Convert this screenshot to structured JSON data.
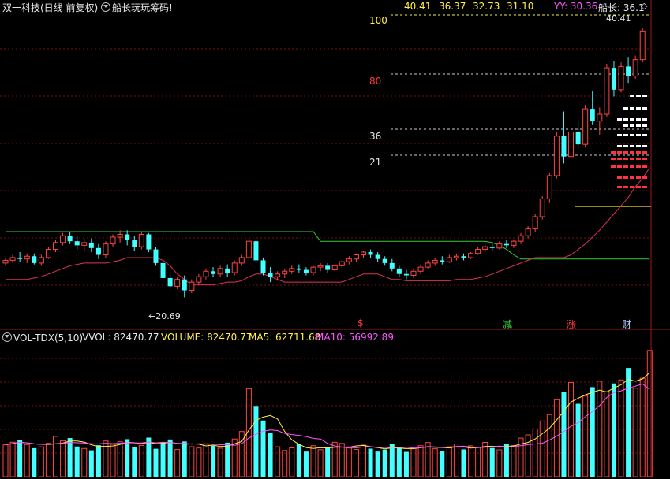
{
  "header": {
    "stock_title": "双一科技(日线 前复权)",
    "indicator_name": "船长玩玩筹码!",
    "readouts": [
      "40.41",
      "36.37",
      "32.73",
      "31.10"
    ],
    "yy_label": "YY: 30.36",
    "captain_label": "船长: 36.1"
  },
  "price_panel": {
    "level_labels": [
      "100",
      "80",
      "36",
      "21"
    ],
    "high_label": "40.41",
    "low_label": "20.69",
    "markers": [
      "$",
      "减",
      "涨",
      "财"
    ]
  },
  "volume_panel": {
    "indicator": "VOL-TDX(5,10)",
    "vvol": "VVOL: 82470.77",
    "volume": "VOLUME: 82470.77",
    "ma5": "MA5: 62711.68",
    "ma10": "MA10: 56992.89"
  },
  "colors": {
    "up": "#ff4444",
    "down": "#44ffff",
    "ma5": "#ffee44",
    "ma10": "#ff55ff",
    "support": "#33cc33",
    "bottom": "#dd3355"
  },
  "chart_data": {
    "type": "candlestick",
    "series": [
      {
        "name": "K",
        "ohlc": [
          [
            23.2,
            23.6,
            23.0,
            23.4
          ],
          [
            23.4,
            23.8,
            23.2,
            23.6
          ],
          [
            23.6,
            24.0,
            23.3,
            23.5
          ],
          [
            23.5,
            23.9,
            23.2,
            23.7
          ],
          [
            23.7,
            23.9,
            23.1,
            23.2
          ],
          [
            23.2,
            23.8,
            23.0,
            23.6
          ],
          [
            23.6,
            24.4,
            23.5,
            24.2
          ],
          [
            24.2,
            24.9,
            24.0,
            24.7
          ],
          [
            24.7,
            25.4,
            24.5,
            25.2
          ],
          [
            25.2,
            25.5,
            24.6,
            24.8
          ],
          [
            24.8,
            25.2,
            24.2,
            24.5
          ],
          [
            24.5,
            25.0,
            24.1,
            24.7
          ],
          [
            24.7,
            25.0,
            24.0,
            24.3
          ],
          [
            24.3,
            24.6,
            23.5,
            23.8
          ],
          [
            23.8,
            24.8,
            23.6,
            24.6
          ],
          [
            24.6,
            25.3,
            24.4,
            25.1
          ],
          [
            25.1,
            25.6,
            24.7,
            25.3
          ],
          [
            25.3,
            25.6,
            24.5,
            24.9
          ],
          [
            24.9,
            25.2,
            24.1,
            24.4
          ],
          [
            24.4,
            25.5,
            24.2,
            25.3
          ],
          [
            25.3,
            25.4,
            24.0,
            24.2
          ],
          [
            24.2,
            24.4,
            23.0,
            23.2
          ],
          [
            23.2,
            23.4,
            21.9,
            22.1
          ],
          [
            22.1,
            22.4,
            21.3,
            21.5
          ],
          [
            21.5,
            22.2,
            21.3,
            22.0
          ],
          [
            22.0,
            22.3,
            20.69,
            21.2
          ],
          [
            21.2,
            22.0,
            21.0,
            21.8
          ],
          [
            21.8,
            22.4,
            21.6,
            22.2
          ],
          [
            22.2,
            22.8,
            22.0,
            22.6
          ],
          [
            22.6,
            22.9,
            22.2,
            22.4
          ],
          [
            22.4,
            23.0,
            22.2,
            22.8
          ],
          [
            22.8,
            23.1,
            22.2,
            22.5
          ],
          [
            22.5,
            23.4,
            22.3,
            23.2
          ],
          [
            23.2,
            23.8,
            23.0,
            23.6
          ],
          [
            23.6,
            25.0,
            23.4,
            24.8
          ],
          [
            24.8,
            25.0,
            23.2,
            23.4
          ],
          [
            23.4,
            23.6,
            22.3,
            22.5
          ],
          [
            22.5,
            22.9,
            21.8,
            22.2
          ],
          [
            22.2,
            22.6,
            21.9,
            22.4
          ],
          [
            22.4,
            22.8,
            22.1,
            22.6
          ],
          [
            22.6,
            23.0,
            22.4,
            22.8
          ],
          [
            22.8,
            23.1,
            22.5,
            22.7
          ],
          [
            22.7,
            22.9,
            22.3,
            22.5
          ],
          [
            22.5,
            23.0,
            22.3,
            22.9
          ],
          [
            22.9,
            23.2,
            22.6,
            23.0
          ],
          [
            23.0,
            23.2,
            22.5,
            22.7
          ],
          [
            22.7,
            23.1,
            22.6,
            23.0
          ],
          [
            23.0,
            23.4,
            22.8,
            23.3
          ],
          [
            23.3,
            23.7,
            23.1,
            23.5
          ],
          [
            23.5,
            23.9,
            23.3,
            23.8
          ],
          [
            23.8,
            24.1,
            23.6,
            24.0
          ],
          [
            24.0,
            24.2,
            23.6,
            23.8
          ],
          [
            23.8,
            24.0,
            23.3,
            23.5
          ],
          [
            23.5,
            23.7,
            23.0,
            23.2
          ],
          [
            23.2,
            23.5,
            22.6,
            22.8
          ],
          [
            22.8,
            23.0,
            22.2,
            22.4
          ],
          [
            22.4,
            22.7,
            22.0,
            22.3
          ],
          [
            22.3,
            22.8,
            22.1,
            22.6
          ],
          [
            22.6,
            23.1,
            22.4,
            22.9
          ],
          [
            22.9,
            23.4,
            22.8,
            23.2
          ],
          [
            23.2,
            23.6,
            23.0,
            23.4
          ],
          [
            23.4,
            23.7,
            23.1,
            23.3
          ],
          [
            23.3,
            23.8,
            23.2,
            23.6
          ],
          [
            23.6,
            23.9,
            23.4,
            23.7
          ],
          [
            23.7,
            23.9,
            23.4,
            23.6
          ],
          [
            23.6,
            24.0,
            23.5,
            23.9
          ],
          [
            23.9,
            24.4,
            23.8,
            24.2
          ],
          [
            24.2,
            24.6,
            24.0,
            24.4
          ],
          [
            24.4,
            24.7,
            24.1,
            24.3
          ],
          [
            24.3,
            24.8,
            24.2,
            24.6
          ],
          [
            24.6,
            24.9,
            24.3,
            24.5
          ],
          [
            24.5,
            24.9,
            24.3,
            24.8
          ],
          [
            24.8,
            25.4,
            24.6,
            25.2
          ],
          [
            25.2,
            25.9,
            25.0,
            25.7
          ],
          [
            25.7,
            26.8,
            25.5,
            26.6
          ],
          [
            26.6,
            28.1,
            26.4,
            27.9
          ],
          [
            27.9,
            29.8,
            27.6,
            29.6
          ],
          [
            29.6,
            32.8,
            29.4,
            32.5
          ],
          [
            32.5,
            34.3,
            30.5,
            31.0
          ],
          [
            31.0,
            33.0,
            30.6,
            32.8
          ],
          [
            32.8,
            33.6,
            31.6,
            31.9
          ],
          [
            31.9,
            34.8,
            31.7,
            34.5
          ],
          [
            34.5,
            35.8,
            33.3,
            33.6
          ],
          [
            33.6,
            34.6,
            32.6,
            34.1
          ],
          [
            34.1,
            37.8,
            33.9,
            37.5
          ],
          [
            37.5,
            38.0,
            35.4,
            35.9
          ],
          [
            35.9,
            37.9,
            35.7,
            37.6
          ],
          [
            37.6,
            38.3,
            36.4,
            36.9
          ],
          [
            36.9,
            38.4,
            36.7,
            38.1
          ],
          [
            38.1,
            40.41,
            37.9,
            40.2
          ]
        ]
      }
    ],
    "volume_series": [
      {
        "name": "VOLUME",
        "values": [
          20800,
          22500,
          24100,
          21000,
          18600,
          19500,
          21800,
          26300,
          23500,
          25200,
          19700,
          18400,
          17200,
          20500,
          23300,
          21100,
          22800,
          24500,
          19100,
          20400,
          25500,
          18200,
          22400,
          24300,
          17700,
          23000,
          19600,
          18700,
          21500,
          20200,
          18600,
          22200,
          24600,
          29500,
          57500,
          46200,
          36700,
          28400,
          19500,
          17100,
          18800,
          21300,
          16400,
          20200,
          17600,
          19000,
          22500,
          21700,
          19400,
          17800,
          20600,
          18300,
          16400,
          17700,
          21200,
          19400,
          16200,
          18600,
          20200,
          22300,
          18200,
          16800,
          19500,
          21300,
          17800,
          20100,
          19200,
          22400,
          18700,
          17500,
          21300,
          20300,
          25200,
          27300,
          31200,
          36400,
          40600,
          50300,
          55400,
          61500,
          47600,
          52700,
          58500,
          62400,
          55600,
          60900,
          63200,
          71000,
          57800,
          64300,
          82470.77
        ]
      },
      {
        "name": "MA5",
        "values": [
          20800,
          21650,
          22470,
          22100,
          21400,
          21140,
          20980,
          21440,
          21940,
          23260,
          23300,
          22620,
          20800,
          19800,
          19820,
          20040,
          21060,
          22440,
          22160,
          21580,
          22460,
          21540,
          21720,
          22560,
          21620,
          21120,
          21440,
          21200,
          20100,
          20600,
          19720,
          19840,
          21420,
          22980,
          30480,
          36760,
          38940,
          40020,
          37700,
          29580,
          24100,
          21120,
          19000,
          18420,
          18920,
          18720,
          19160,
          19320,
          19200,
          20080,
          20400,
          19560,
          18960,
          18160,
          18840,
          18700,
          18300,
          18220,
          18980,
          19360,
          19140,
          18980,
          18720,
          19620,
          19420,
          18680,
          18980,
          19660,
          19860,
          19740,
          19800,
          20040,
          21380,
          22400,
          24640,
          28060,
          31740,
          37100,
          42820,
          48840,
          51240,
          53500,
          55100,
          56540,
          55300,
          58000,
          60000,
          63600,
          62400,
          63900,
          67900
        ]
      },
      {
        "name": "MA10",
        "values": [
          20800,
          21650,
          22470,
          22100,
          21400,
          21080,
          21110,
          21500,
          21800,
          22260,
          22160,
          21960,
          21540,
          21440,
          21820,
          21580,
          21840,
          22200,
          22000,
          22040,
          22660,
          22090,
          22520,
          22290,
          21730,
          21800,
          21270,
          21520,
          21210,
          21200,
          20880,
          20980,
          20460,
          21560,
          25260,
          27800,
          29720,
          30530,
          30100,
          28250,
          27480,
          27010,
          26230,
          24970,
          24630,
          21680,
          20030,
          19370,
          18700,
          18780,
          19440,
          19640,
          19080,
          19040,
          19110,
          19120,
          19150,
          18650,
          18790,
          19720,
          19470,
          19020,
          19310,
          19720,
          19960,
          19310,
          18880,
          19190,
          19540,
          19910,
          19350,
          19610,
          20180,
          20890,
          21350,
          21850,
          23960,
          26450,
          29490,
          32920,
          35300,
          39120,
          42520,
          46450,
          51780,
          54900,
          56100,
          57900,
          59100,
          60600,
          56992.89
        ]
      }
    ],
    "indicator_lines": [
      {
        "name": "support",
        "values": [
          25.5,
          25.5,
          25.5,
          25.5,
          25.5,
          25.5,
          25.5,
          25.5,
          25.5,
          25.5,
          25.5,
          25.5,
          25.5,
          25.5,
          25.5,
          25.5,
          25.5,
          25.5,
          25.5,
          25.5,
          25.5,
          25.5,
          25.5,
          25.5,
          25.5,
          25.5,
          25.5,
          25.5,
          25.5,
          25.5,
          25.5,
          25.5,
          25.5,
          25.5,
          25.5,
          25.5,
          25.5,
          25.5,
          25.5,
          25.5,
          25.5,
          25.5,
          25.5,
          25.5,
          24.8,
          24.8,
          24.8,
          24.8,
          24.8,
          24.8,
          24.8,
          24.8,
          24.8,
          24.8,
          24.8,
          24.8,
          24.8,
          24.8,
          24.8,
          24.8,
          24.8,
          24.8,
          24.8,
          24.8,
          24.8,
          24.8,
          24.8,
          24.8,
          24.7,
          24.5,
          24.2,
          23.8,
          23.5,
          23.5,
          23.5,
          23.5,
          23.5,
          23.5,
          23.5,
          23.5,
          23.5,
          23.5,
          23.5,
          23.5,
          23.5,
          23.5,
          23.5,
          23.5,
          23.5,
          23.5,
          23.5
        ]
      },
      {
        "name": "bottom",
        "values": [
          22.0,
          22.0,
          22.0,
          22.0,
          22.1,
          22.2,
          22.4,
          22.6,
          22.8,
          23.0,
          23.1,
          23.2,
          23.2,
          23.2,
          23.2,
          23.3,
          23.4,
          23.6,
          23.6,
          23.6,
          23.6,
          23.6,
          23.4,
          23.0,
          22.4,
          22.0,
          21.6,
          21.6,
          21.6,
          21.6,
          21.7,
          21.8,
          21.8,
          21.9,
          22.2,
          22.4,
          22.4,
          22.2,
          22.0,
          21.8,
          21.8,
          21.8,
          21.8,
          21.8,
          21.8,
          21.8,
          21.8,
          21.8,
          22.0,
          22.2,
          22.4,
          22.4,
          22.4,
          22.2,
          22.0,
          22.0,
          21.9,
          21.9,
          21.9,
          21.9,
          21.9,
          21.9,
          21.9,
          22.0,
          22.0,
          22.0,
          22.1,
          22.2,
          22.4,
          22.6,
          22.8,
          23.0,
          23.2,
          23.4,
          23.6,
          23.6,
          23.6,
          23.6,
          23.6,
          23.8,
          24.2,
          24.6,
          25.1,
          25.6,
          26.2,
          26.8,
          27.4,
          28.0,
          28.8,
          29.4,
          30.2
        ]
      }
    ]
  }
}
